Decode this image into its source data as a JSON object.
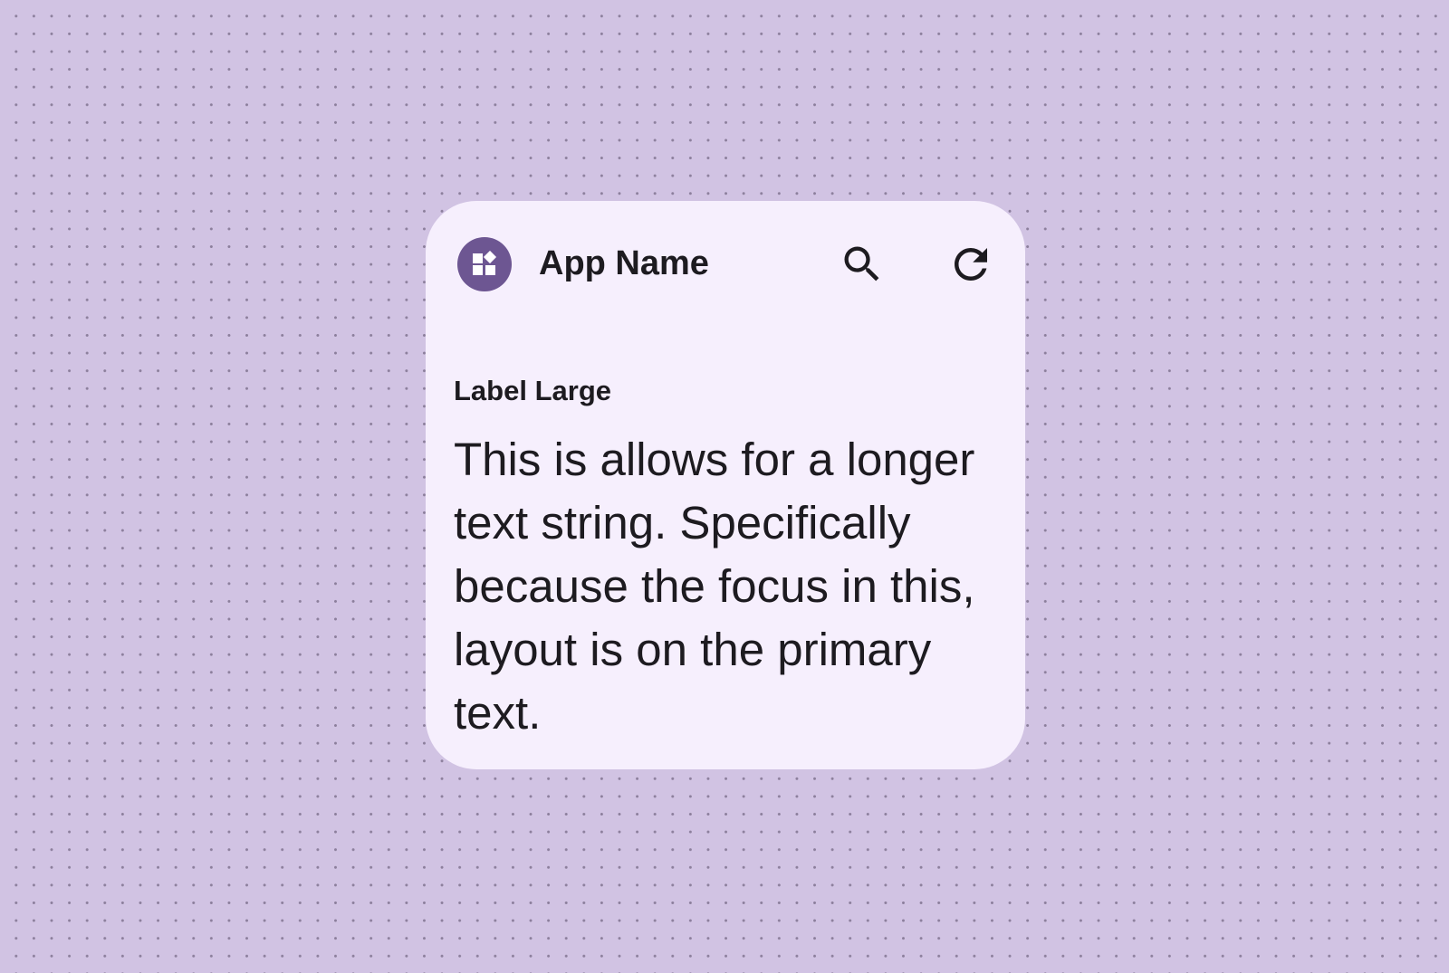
{
  "widget": {
    "app_icon": "widgets-icon",
    "app_name": "App Name",
    "actions": {
      "search_icon": "search-icon",
      "refresh_icon": "refresh-icon"
    },
    "label": "Label Large",
    "body_text": "This is allows for a longer text string. Specifically because the focus in this, layout is on the primary text."
  },
  "colors": {
    "background": "#d1c3e3",
    "dots": "#8c7f9c",
    "card": "#f6effd",
    "accent": "#6d5692",
    "text": "#1d1b20"
  }
}
